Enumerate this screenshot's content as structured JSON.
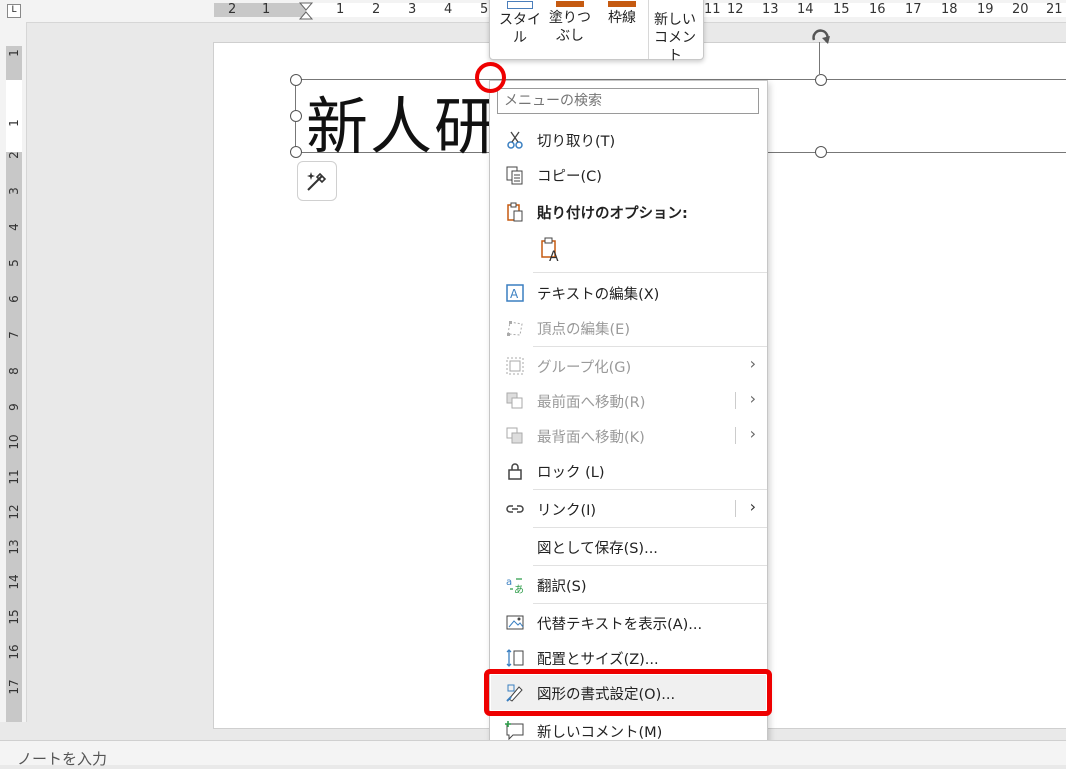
{
  "ruler": {
    "horizontal": [
      "2",
      "1",
      "1",
      "2",
      "3",
      "4",
      "5",
      "11",
      "12",
      "13",
      "14",
      "15",
      "16",
      "17",
      "18",
      "19",
      "20",
      "21"
    ],
    "vertical": [
      "1",
      "1",
      "2",
      "3",
      "4",
      "5",
      "6",
      "7",
      "8",
      "9",
      "10",
      "11",
      "12",
      "13",
      "14",
      "15",
      "16",
      "17"
    ]
  },
  "slide": {
    "title_text": "新人研"
  },
  "mini_toolbar": {
    "items": [
      {
        "label": "スタイル"
      },
      {
        "label": "塗りつぶし"
      },
      {
        "label": "枠線"
      },
      {
        "label": "新しいコメント"
      }
    ]
  },
  "context_menu": {
    "search_placeholder": "メニューの検索",
    "items": [
      {
        "label": "切り取り(T)",
        "icon": "scissors-icon"
      },
      {
        "label": "コピー(C)",
        "icon": "copy-icon"
      },
      {
        "label": "貼り付けのオプション:",
        "icon": "paste-icon"
      },
      {
        "label": "テキストの編集(X)",
        "icon": "edit-text-icon"
      },
      {
        "label": "頂点の編集(E)",
        "icon": "edit-points-icon",
        "disabled": true
      },
      {
        "label": "グループ化(G)",
        "icon": "group-icon",
        "disabled": true
      },
      {
        "label": "最前面へ移動(R)",
        "icon": "bring-front-icon",
        "disabled": true
      },
      {
        "label": "最背面へ移動(K)",
        "icon": "send-back-icon",
        "disabled": true
      },
      {
        "label": "ロック (L)",
        "icon": "lock-icon"
      },
      {
        "label": "リンク(I)",
        "icon": "link-icon"
      },
      {
        "label": "図として保存(S)..."
      },
      {
        "label": "翻訳(S)",
        "icon": "translate-icon"
      },
      {
        "label": "代替テキストを表示(A)...",
        "icon": "alt-text-icon"
      },
      {
        "label": "配置とサイズ(Z)...",
        "icon": "position-size-icon"
      },
      {
        "label": "図形の書式設定(O)...",
        "icon": "format-shape-icon"
      },
      {
        "label": "新しいコメント(M)",
        "icon": "comment-icon"
      }
    ]
  },
  "notes": {
    "placeholder": "ノートを入力"
  },
  "colors": {
    "accent": "#c55a11",
    "highlight": "#ee0000"
  }
}
